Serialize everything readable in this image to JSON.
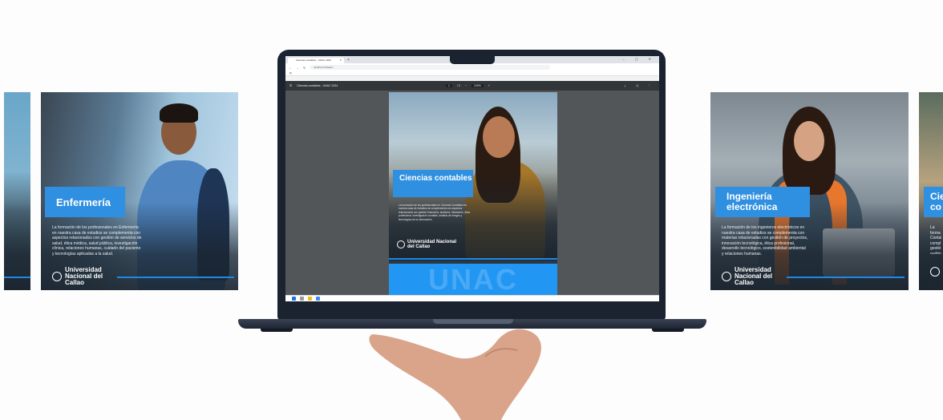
{
  "browser": {
    "tab_title": "Ciencias contables - UNAC 2024",
    "new_tab": "+",
    "window_controls": "– ▢ ✕",
    "url_prefix": "Archivo",
    "url": "C:/Users/..."
  },
  "pdf_viewer": {
    "doc_title": "Ciencias contables - UNAC 2024",
    "page_current": "1",
    "page_total": "/ 2",
    "zoom": "100%",
    "toolbar_right": "⤓ ⎙ ⋮"
  },
  "brochure_center": {
    "program": "Ciencias contables",
    "blurb": "La formación de los profesionales en Ciencias Contables en nuestra casa de estudios se complementa con aspectos relacionados con gestión financiera, auditoría, tributación, ética profesional, investigación contable, análisis de riesgos y tecnologías de la información.",
    "university": "Universidad Nacional del Callao",
    "watermark": "UNAC"
  },
  "brochure_left": {
    "program": "Enfermería",
    "blurb": "La formación de los profesionales en Enfermería en nuestra casa de estudios se complementa con aspectos relacionados con gestión de servicios de salud, ética médica, salud pública, investigación clínica, relaciones humanas, cuidado del paciente y tecnologías aplicadas a la salud.",
    "university": "Universidad Nacional del Callao"
  },
  "brochure_right": {
    "program": "Ingeniería electrónica",
    "blurb": "La formación de los ingenieros electrónicos en nuestra casa de estudios se complementa con materias relacionadas con gestión de proyectos, innovación tecnológica, ética profesional, desarrollo tecnológico, sostenibilidad ambiental y relaciones humanas.",
    "university": "Universidad Nacional del Callao"
  },
  "brochure_right_far": {
    "program_partial": "Cie co",
    "blurb_partial": "La forma Contab compl gestió audito invest tecno"
  },
  "colors": {
    "accent_blue": "#2f8fe0",
    "laptop_body": "#1b2230",
    "pdf_background": "#525659"
  }
}
